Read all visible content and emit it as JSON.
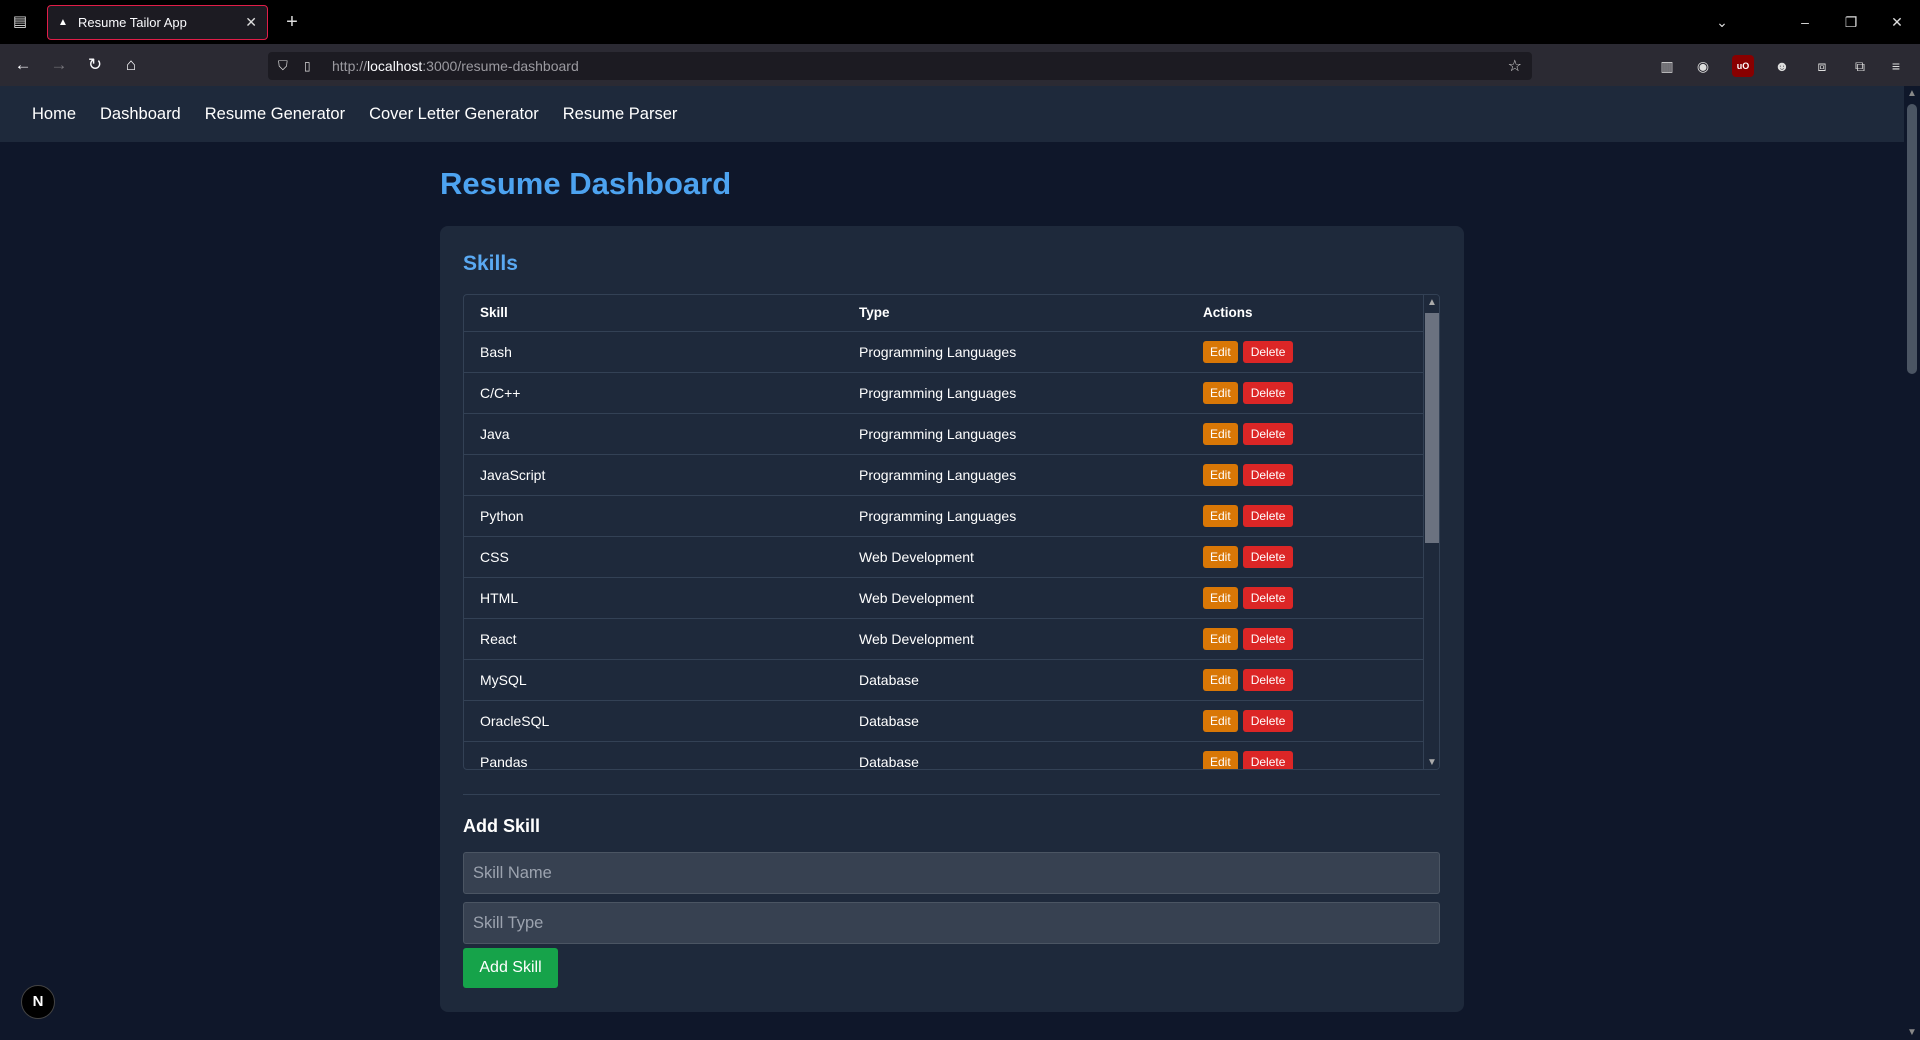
{
  "browser": {
    "tab_title": "Resume Tailor App",
    "url_prefix": "http://",
    "url_host": "localhost",
    "url_path": ":3000/resume-dashboard"
  },
  "nav": {
    "items": [
      {
        "label": "Home"
      },
      {
        "label": "Dashboard"
      },
      {
        "label": "Resume Generator"
      },
      {
        "label": "Cover Letter Generator"
      },
      {
        "label": "Resume Parser"
      }
    ]
  },
  "page": {
    "title": "Resume Dashboard"
  },
  "skills": {
    "section_title": "Skills",
    "columns": {
      "skill": "Skill",
      "type": "Type",
      "actions": "Actions"
    },
    "edit_label": "Edit",
    "delete_label": "Delete",
    "rows": [
      {
        "skill": "Bash",
        "type": "Programming Languages"
      },
      {
        "skill": "C/C++",
        "type": "Programming Languages"
      },
      {
        "skill": "Java",
        "type": "Programming Languages"
      },
      {
        "skill": "JavaScript",
        "type": "Programming Languages"
      },
      {
        "skill": "Python",
        "type": "Programming Languages"
      },
      {
        "skill": "CSS",
        "type": "Web Development"
      },
      {
        "skill": "HTML",
        "type": "Web Development"
      },
      {
        "skill": "React",
        "type": "Web Development"
      },
      {
        "skill": "MySQL",
        "type": "Database"
      },
      {
        "skill": "OracleSQL",
        "type": "Database"
      },
      {
        "skill": "Pandas",
        "type": "Database"
      }
    ]
  },
  "add_skill": {
    "title": "Add Skill",
    "name_placeholder": "Skill Name",
    "type_placeholder": "Skill Type",
    "button_label": "Add Skill"
  },
  "badge": {
    "letter": "N"
  },
  "colors": {
    "accent": "#4da3f0",
    "edit": "#d97706",
    "delete": "#dc2626",
    "add": "#16a34a"
  }
}
